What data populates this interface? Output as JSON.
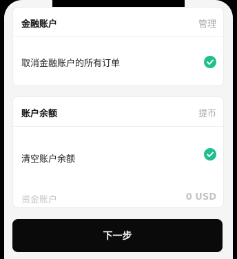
{
  "financial_account": {
    "title": "金融账户",
    "manage_label": "管理",
    "cancel_orders_label": "取消金融账户的所有订单"
  },
  "account_balance": {
    "title": "账户余额",
    "withdraw_label": "提币",
    "clear_balance_label": "清空账户余额",
    "funding_account_label": "资金账户",
    "funding_account_value": "0 USD"
  },
  "next_button_label": "下一步",
  "colors": {
    "check_green": "#1fc08e",
    "button_black": "#0a0a0a"
  },
  "icons": {
    "cancel_orders_check": "check-circle-icon",
    "clear_balance_check": "check-circle-icon"
  }
}
